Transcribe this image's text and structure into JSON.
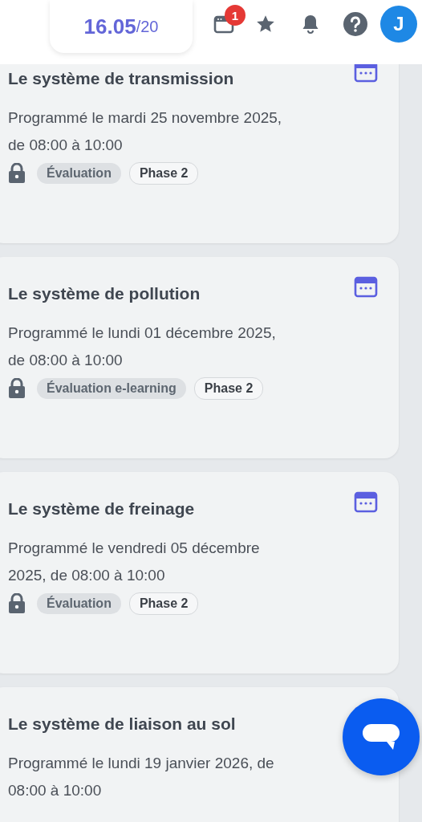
{
  "header": {
    "score": "16.05",
    "score_total": "/20",
    "notification_count": "1",
    "avatar_initial": "J"
  },
  "sessions": [
    {
      "title": "Le système de transmission",
      "schedule": "Programmé le mardi 25 novembre 2025, de 08:00 à 10:00",
      "locked": true,
      "tags": [
        {
          "label": "Évaluation",
          "kind": "type"
        },
        {
          "label": "Phase 2",
          "kind": "phase"
        }
      ]
    },
    {
      "title": "Le système de pollution",
      "schedule": "Programmé le lundi 01 décembre 2025, de 08:00 à 10:00",
      "locked": true,
      "tags": [
        {
          "label": "Évaluation e-learning",
          "kind": "type"
        },
        {
          "label": "Phase 2",
          "kind": "phase"
        }
      ]
    },
    {
      "title": "Le système de freinage",
      "schedule": "Programmé le vendredi 05 décembre 2025, de 08:00 à 10:00",
      "locked": true,
      "tags": [
        {
          "label": "Évaluation",
          "kind": "type"
        },
        {
          "label": "Phase 2",
          "kind": "phase"
        }
      ]
    },
    {
      "title": "Le système de liaison au sol",
      "schedule": "Programmé le lundi 19 janvier 2026, de 08:00 à 10:00"
    }
  ]
}
